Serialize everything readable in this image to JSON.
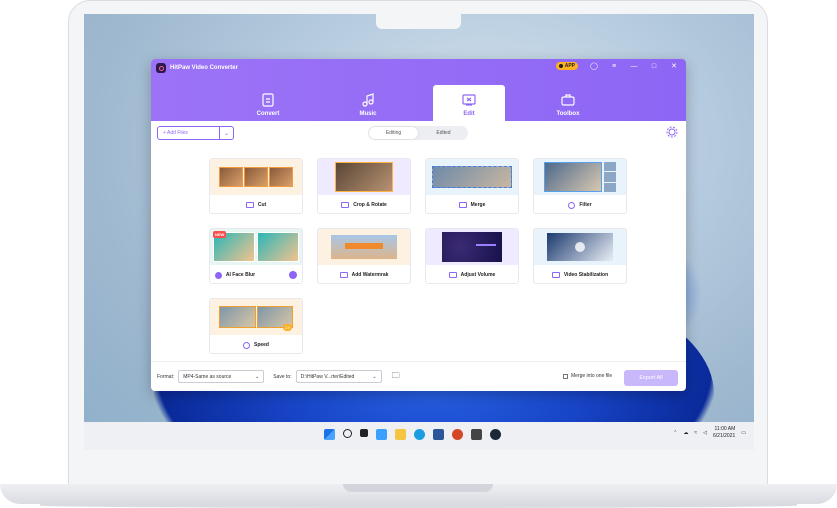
{
  "app": {
    "title": "HitPaw Video Converter",
    "app_badge": "APP",
    "main_tabs": [
      {
        "label": "Convert"
      },
      {
        "label": "Music"
      },
      {
        "label": "Edit"
      },
      {
        "label": "Toolbox"
      }
    ],
    "add_files_label": "+ Add Files",
    "segments": [
      "Editing",
      "Edited"
    ],
    "tools": [
      {
        "label": "Cut"
      },
      {
        "label": "Crop & Rotate"
      },
      {
        "label": "Merge"
      },
      {
        "label": "Filter"
      },
      {
        "label": "AI Face Blur",
        "badge": "NEW"
      },
      {
        "label": "Add Watermrak"
      },
      {
        "label": "Adjust Volume"
      },
      {
        "label": "Video Stabilization"
      },
      {
        "label": "Speed",
        "badge": "2X"
      }
    ],
    "footer": {
      "format_label": "Format:",
      "format_value": "MP4-Same as source",
      "saveto_label": "Save to:",
      "saveto_value": "D:\\HitPaw V...rter\\Edited",
      "merge_label": "Merge into one file",
      "export_label": "Export All"
    },
    "accent": "#8d66f5"
  },
  "taskbar": {
    "time": "11:00 AM",
    "date": "6/21/2021"
  }
}
